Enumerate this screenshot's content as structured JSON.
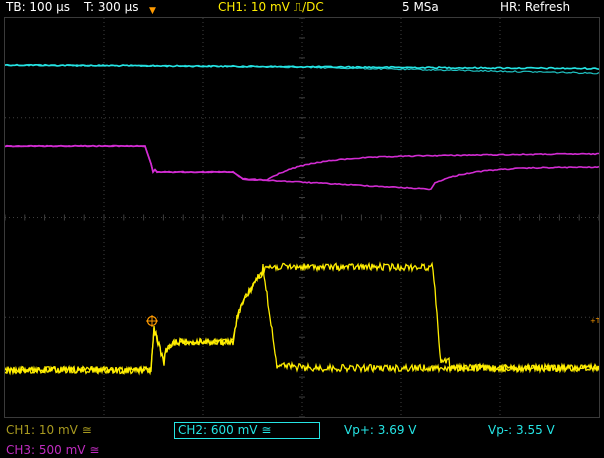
{
  "header": {
    "timebase": "TB: 100 µs",
    "trigger_time": "T: 300 µs",
    "ch1_trigger": "CH1: 10 mV ⎍/DC",
    "sample_rate": "5 MSa",
    "horizontal_mode": "HR: Refresh"
  },
  "footer": {
    "ch1": "CH1: 10 mV ≅",
    "ch2": "CH2: 600 mV ≅",
    "vp_plus": "Vp+: 3.69 V",
    "vp_minus": "Vp-: 3.55 V",
    "ch3": "CH3: 500 mV ≅"
  },
  "colors": {
    "ch1": "#ffee00",
    "ch2": "#25e5e5",
    "ch3": "#d22cd2",
    "grid": "#444444",
    "trigger": "#ff9a00"
  },
  "trigger_level_label": "+T"
}
